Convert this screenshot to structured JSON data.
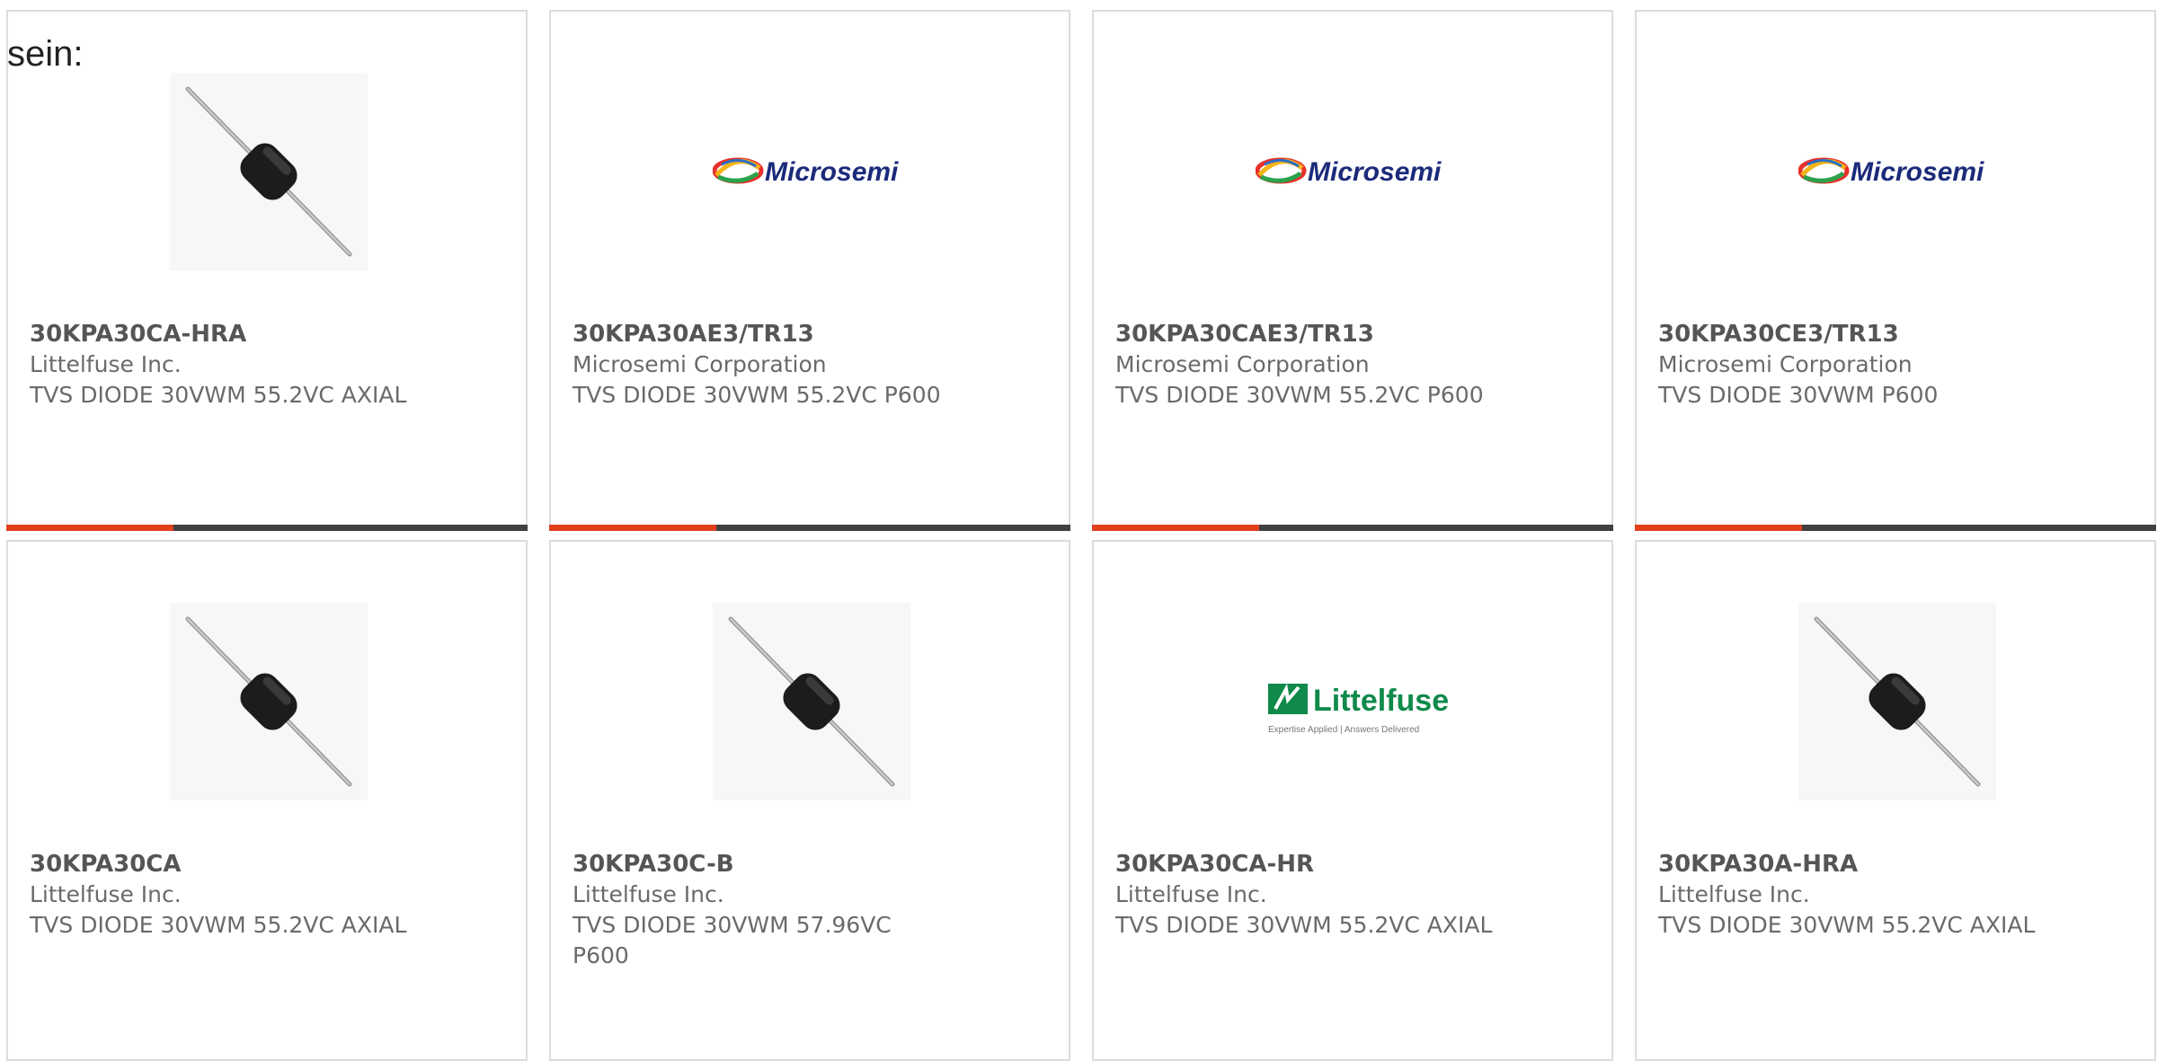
{
  "lead_text": "sein:",
  "colors": {
    "card_border": "#dcdcdc",
    "accent_bar": "#e2401c",
    "dark_bar": "#404040",
    "microsemi_brand": "#1b2a7a",
    "littelfuse_brand": "#0f8a4a"
  },
  "products": [
    {
      "part_number": "30KPA30CA-HRA",
      "manufacturer": "Littelfuse Inc.",
      "description": "TVS DIODE 30VWM 55.2VC AXIAL",
      "image": "axial-diode-image"
    },
    {
      "part_number": "30KPA30AE3/TR13",
      "manufacturer": "Microsemi Corporation",
      "description": "TVS DIODE 30VWM 55.2VC P600",
      "image": "microsemi-logo",
      "logo_text": "Microsemi"
    },
    {
      "part_number": "30KPA30CAE3/TR13",
      "manufacturer": "Microsemi Corporation",
      "description": "TVS DIODE 30VWM 55.2VC P600",
      "image": "microsemi-logo",
      "logo_text": "Microsemi"
    },
    {
      "part_number": "30KPA30CE3/TR13",
      "manufacturer": "Microsemi Corporation",
      "description": "TVS DIODE 30VWM P600",
      "image": "microsemi-logo",
      "logo_text": "Microsemi"
    },
    {
      "part_number": "30KPA30CA",
      "manufacturer": "Littelfuse Inc.",
      "description": "TVS DIODE 30VWM 55.2VC AXIAL",
      "image": "axial-diode-image"
    },
    {
      "part_number": "30KPA30C-B",
      "manufacturer": "Littelfuse Inc.",
      "description": "TVS DIODE 30VWM 57.96VC P600",
      "image": "axial-diode-image"
    },
    {
      "part_number": "30KPA30CA-HR",
      "manufacturer": "Littelfuse Inc.",
      "description": "TVS DIODE 30VWM 55.2VC AXIAL",
      "image": "littelfuse-logo",
      "logo_text": "Littelfuse",
      "logo_tagline": "Expertise Applied | Answers Delivered"
    },
    {
      "part_number": "30KPA30A-HRA",
      "manufacturer": "Littelfuse Inc.",
      "description": "TVS DIODE 30VWM 55.2VC AXIAL",
      "image": "axial-diode-image"
    }
  ]
}
